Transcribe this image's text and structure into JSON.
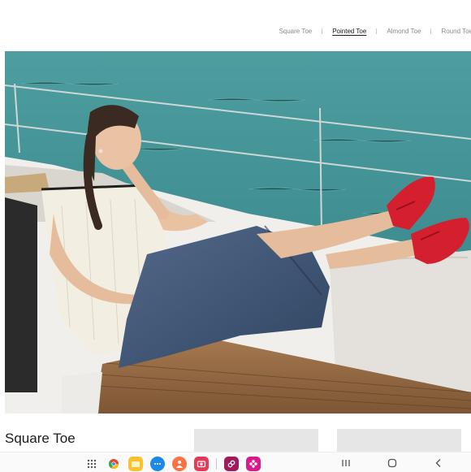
{
  "tabs": [
    {
      "label": "Square Toe",
      "active": false
    },
    {
      "label": "Pointed Toe",
      "active": true
    },
    {
      "label": "Almond Toe",
      "active": false
    },
    {
      "label": "Round Toe",
      "active": false
    }
  ],
  "section_title": "Square Toe",
  "taskbar": {
    "apps": [
      {
        "name": "apps-grid-icon",
        "color": "#555555"
      },
      {
        "name": "chrome-icon",
        "color": "#ea4335"
      },
      {
        "name": "files-icon",
        "color": "#fbc02d"
      },
      {
        "name": "messages-icon",
        "color": "#1e88e5"
      },
      {
        "name": "contacts-icon",
        "color": "#ff7043"
      },
      {
        "name": "camera-icon",
        "color": "#e53958"
      },
      {
        "name": "link-app-icon",
        "color": "#a01a5c"
      },
      {
        "name": "flower-app-icon",
        "color": "#d81b8c"
      }
    ]
  },
  "colors": {
    "accent_red": "#d4202e",
    "sea": "#3f8e91",
    "denim": "#3e5572"
  }
}
